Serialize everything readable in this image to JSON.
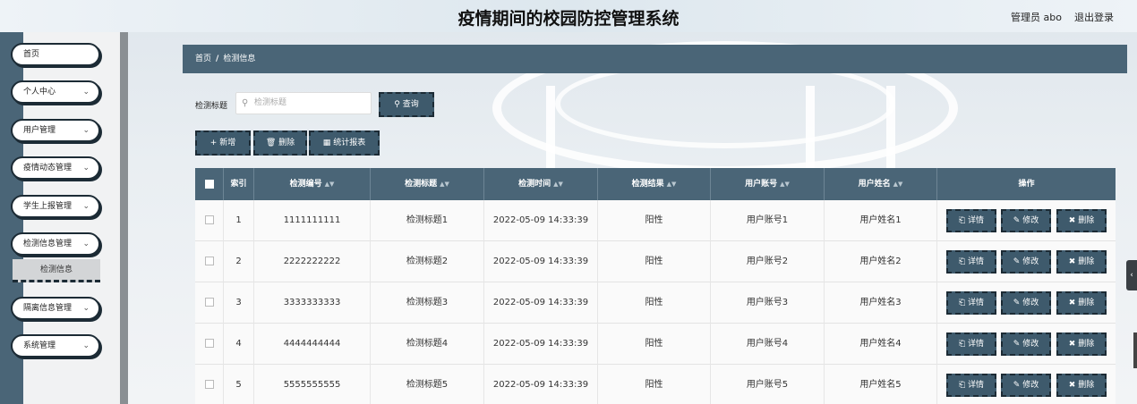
{
  "header": {
    "title": "疫情期间的校园防控管理系统",
    "user": "管理员 abo",
    "logout": "退出登录"
  },
  "sidebar": {
    "items": [
      {
        "label": "首页",
        "has_chevron": false
      },
      {
        "label": "个人中心",
        "has_chevron": true
      },
      {
        "label": "用户管理",
        "has_chevron": true
      },
      {
        "label": "疫情动态管理",
        "has_chevron": true
      },
      {
        "label": "学生上报管理",
        "has_chevron": true
      },
      {
        "label": "检测信息管理",
        "has_chevron": true
      },
      {
        "label": "隔离信息管理",
        "has_chevron": true
      },
      {
        "label": "系统管理",
        "has_chevron": true
      }
    ],
    "submenu": {
      "label": "检测信息"
    },
    "chevron": "⌄"
  },
  "breadcrumb": {
    "home": "首页",
    "separator": "/",
    "current": "检测信息"
  },
  "search": {
    "label": "检测标题",
    "placeholder": "检测标题",
    "query_button": "查询"
  },
  "actions": {
    "add": "新增",
    "delete": "删除",
    "report": "统计报表"
  },
  "table": {
    "columns": [
      "索引",
      "检测编号",
      "检测标题",
      "检测时间",
      "检测结果",
      "用户账号",
      "用户姓名",
      "操作"
    ],
    "rows": [
      {
        "index": "1",
        "code": "1111111111",
        "title": "检测标题1",
        "time": "2022-05-09 14:33:39",
        "result": "阳性",
        "account": "用户账号1",
        "name": "用户姓名1"
      },
      {
        "index": "2",
        "code": "2222222222",
        "title": "检测标题2",
        "time": "2022-05-09 14:33:39",
        "result": "阳性",
        "account": "用户账号2",
        "name": "用户姓名2"
      },
      {
        "index": "3",
        "code": "3333333333",
        "title": "检测标题3",
        "time": "2022-05-09 14:33:39",
        "result": "阳性",
        "account": "用户账号3",
        "name": "用户姓名3"
      },
      {
        "index": "4",
        "code": "4444444444",
        "title": "检测标题4",
        "time": "2022-05-09 14:33:39",
        "result": "阳性",
        "account": "用户账号4",
        "name": "用户姓名4"
      },
      {
        "index": "5",
        "code": "5555555555",
        "title": "检测标题5",
        "time": "2022-05-09 14:33:39",
        "result": "阳性",
        "account": "用户账号5",
        "name": "用户姓名5"
      }
    ],
    "row_actions": {
      "detail": "详情",
      "edit": "修改",
      "delete": "删除"
    }
  },
  "icons": {
    "search": "search-icon",
    "plus": "plus-icon",
    "trash": "trash-icon",
    "chart": "bar-chart-icon",
    "sort": "sort-icon",
    "detail": "document-icon",
    "edit": "pencil-icon",
    "collapse": "chevron-left-icon"
  },
  "colors": {
    "primary": "#4a6577",
    "button": "#3e5a6c",
    "border": "#1c2b35"
  }
}
